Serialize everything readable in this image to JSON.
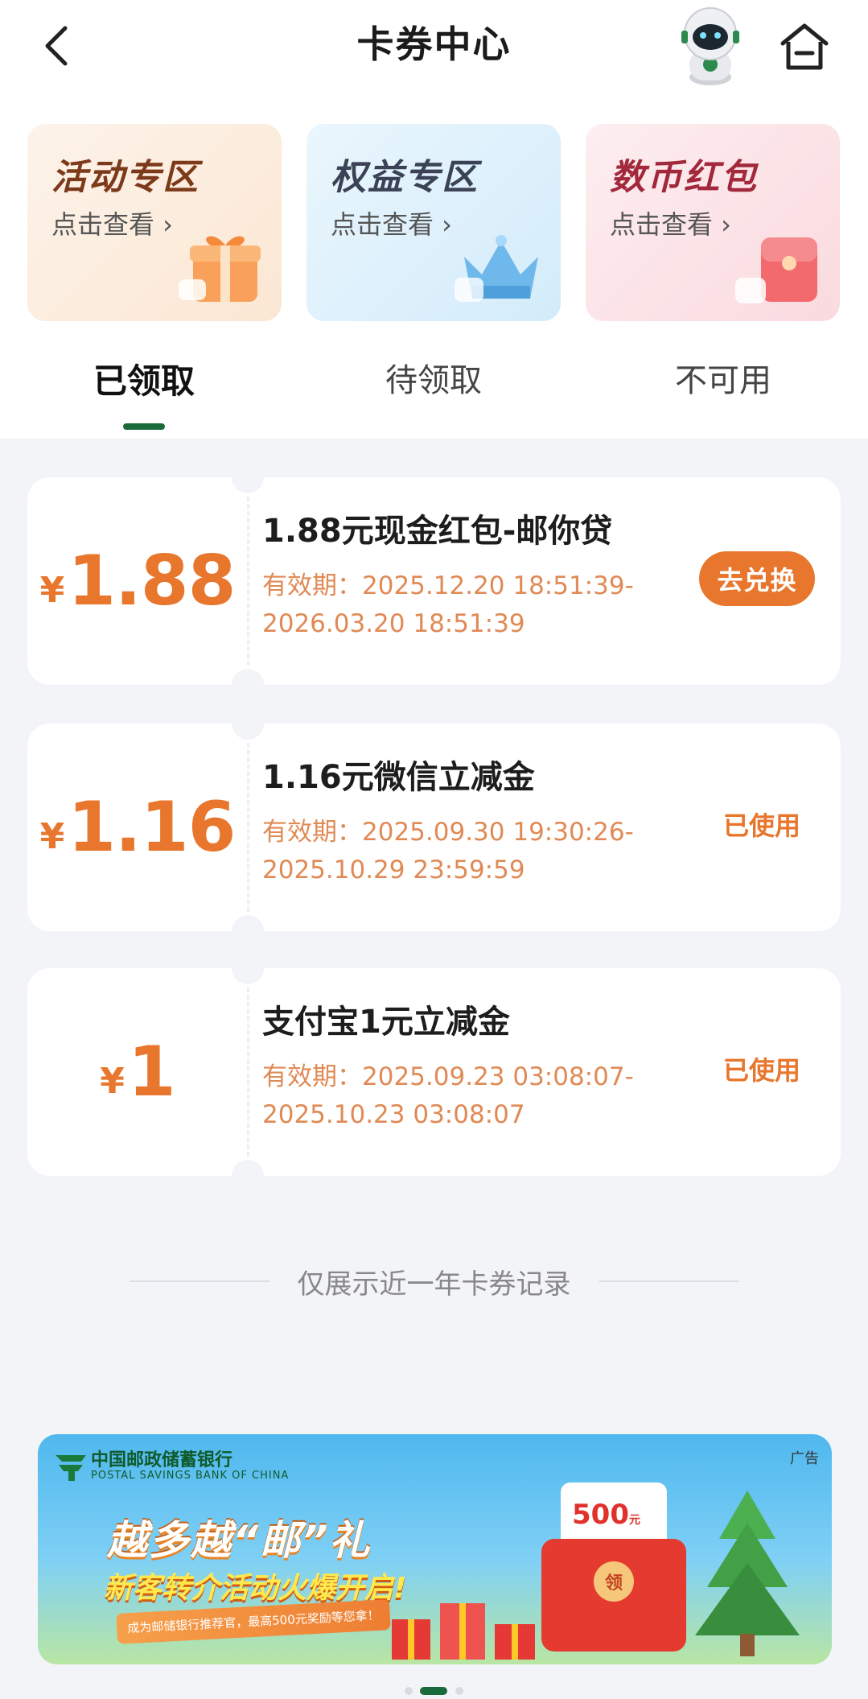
{
  "header": {
    "title": "卡券中心",
    "back_icon": "chevron-left-icon",
    "home_icon": "home-icon"
  },
  "zones": [
    {
      "title": "活动专区",
      "subtitle": "点击查看 ›",
      "icon": "gift-box-icon"
    },
    {
      "title": "权益专区",
      "subtitle": "点击查看 ›",
      "icon": "crown-icon"
    },
    {
      "title": "数币红包",
      "subtitle": "点击查看 ›",
      "icon": "red-envelope-icon"
    }
  ],
  "tabs": [
    {
      "label": "已领取",
      "active": true
    },
    {
      "label": "待领取",
      "active": false
    },
    {
      "label": "不可用",
      "active": false
    }
  ],
  "coupons": [
    {
      "currency": "¥",
      "amount": "1.88",
      "name": "1.88元现金红包-邮你贷",
      "validity_line1": "有效期：2025.12.20 18:51:39-",
      "validity_line2": "2026.03.20 18:51:39",
      "action": "去兑换"
    },
    {
      "currency": "¥",
      "amount": "1.16",
      "name": "1.16元微信立减金",
      "validity_line1": "有效期：2025.09.30 19:30:26-",
      "validity_line2": "2025.10.29 23:59:59",
      "status": "已使用"
    },
    {
      "currency": "¥",
      "amount": "1",
      "name": "支付宝1元立减金",
      "validity_line1": "有效期：2025.09.23 03:08:07-",
      "validity_line2": "2025.10.23 03:08:07",
      "status": "已使用"
    }
  ],
  "footer_note": "仅展示近一年卡券记录",
  "ad": {
    "tag": "广告",
    "bank_name": "中国邮政储蓄银行",
    "bank_name_en": "POSTAL SAVINGS BANK OF CHINA",
    "headline": "越多越“邮”礼",
    "subhead": "新客转介活动火爆开启!",
    "ribbon": "成为邮储银行推荐官，最高500元奖励等您拿！",
    "packet_amount": "500",
    "packet_unit": "元",
    "packet_seal": "领"
  },
  "carousel": {
    "pages": 3,
    "active": 1
  },
  "colors": {
    "accent": "#e8762d",
    "brand_green": "#1a6b3a",
    "page_bg": "#f3f4f8"
  }
}
